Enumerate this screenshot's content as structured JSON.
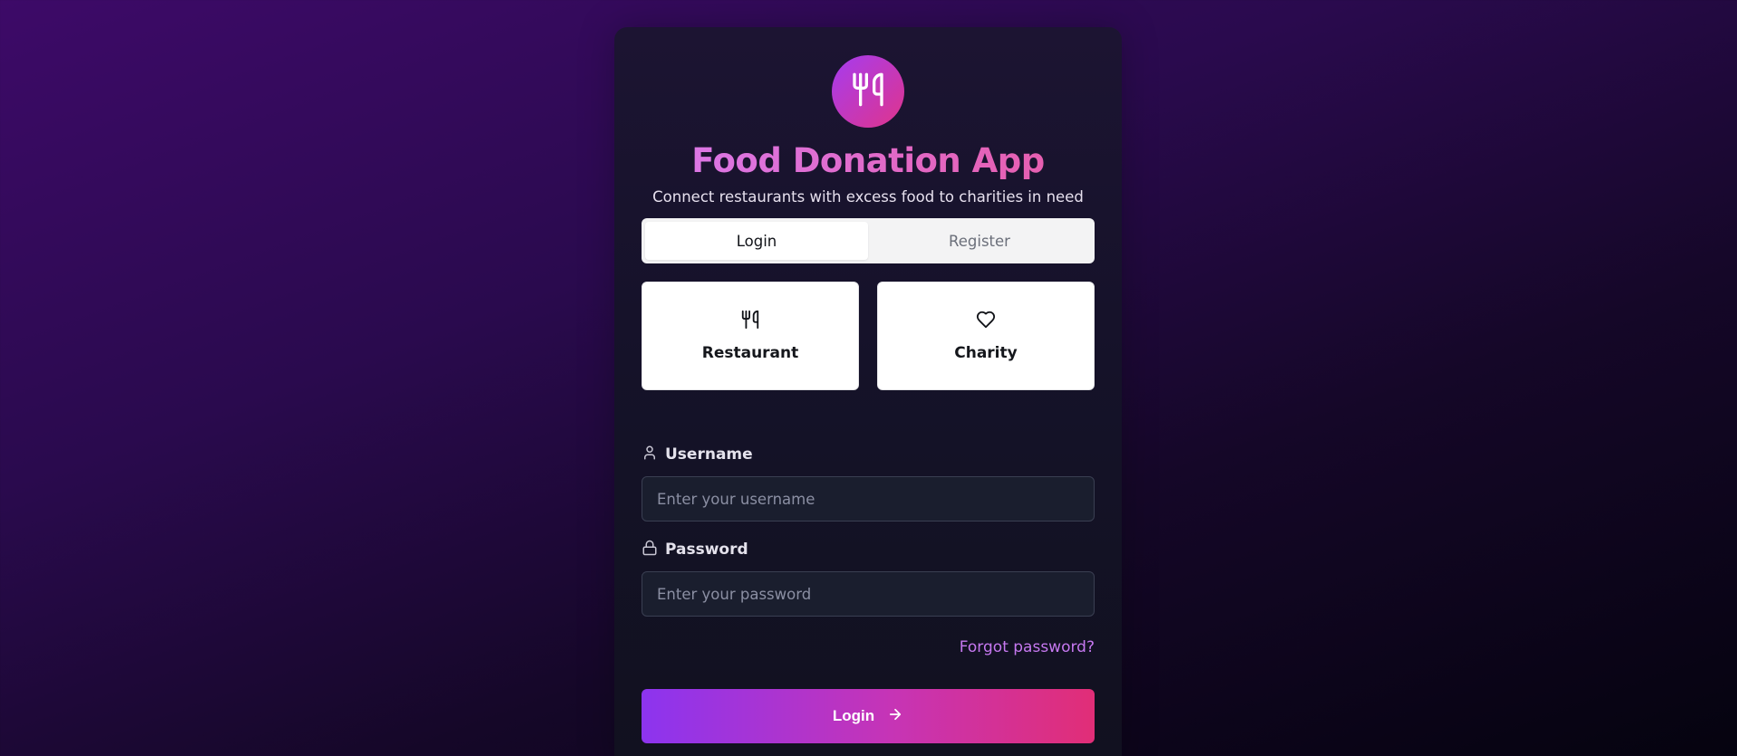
{
  "app": {
    "title": "Food Donation App",
    "subtitle": "Connect restaurants with excess food to charities in need",
    "logo_icon": "utensils-icon"
  },
  "tabs": [
    {
      "label": "Login",
      "active": true
    },
    {
      "label": "Register",
      "active": false
    }
  ],
  "roles": [
    {
      "label": "Restaurant",
      "icon": "utensils-icon"
    },
    {
      "label": "Charity",
      "icon": "heart-icon"
    }
  ],
  "form": {
    "username": {
      "label": "Username",
      "placeholder": "Enter your username",
      "value": "",
      "icon": "user-icon"
    },
    "password": {
      "label": "Password",
      "placeholder": "Enter your password",
      "value": "",
      "icon": "lock-icon"
    },
    "forgot_label": "Forgot password?",
    "submit_label": "Login",
    "submit_icon": "arrow-right-icon"
  },
  "colors": {
    "accent_start": "#8c34ef",
    "accent_end": "#e12e77",
    "link": "#c678f0"
  }
}
